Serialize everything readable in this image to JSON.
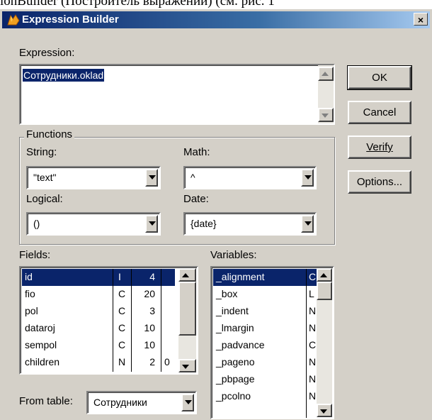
{
  "background_text": "ionBuilder (Построитель выражений) (см. рис. 1",
  "window": {
    "title": "Expression Builder",
    "close_glyph": "×"
  },
  "expression": {
    "label": "Expression:",
    "value": "Сотрудники.oklad"
  },
  "buttons": {
    "ok": "OK",
    "cancel": "Cancel",
    "verify": "Verify",
    "options": "Options..."
  },
  "functions": {
    "title": "Functions",
    "string": {
      "label": "String:",
      "value": "\"text\""
    },
    "math": {
      "label": "Math:",
      "value": "^"
    },
    "logical": {
      "label": "Logical:",
      "value": "()"
    },
    "date": {
      "label": "Date:",
      "value": "{date}"
    }
  },
  "fields": {
    "label": "Fields:",
    "rows": [
      {
        "name": "id",
        "type": "I",
        "width": "4",
        "dec": "",
        "selected": true
      },
      {
        "name": "fio",
        "type": "C",
        "width": "20",
        "dec": ""
      },
      {
        "name": "pol",
        "type": "C",
        "width": "3",
        "dec": ""
      },
      {
        "name": "dataroj",
        "type": "C",
        "width": "10",
        "dec": ""
      },
      {
        "name": "sempol",
        "type": "C",
        "width": "10",
        "dec": ""
      },
      {
        "name": "children",
        "type": "N",
        "width": "2",
        "dec": "0"
      }
    ]
  },
  "variables": {
    "label": "Variables:",
    "rows": [
      {
        "name": "_alignment",
        "type": "C",
        "selected": true
      },
      {
        "name": "_box",
        "type": "L"
      },
      {
        "name": "_indent",
        "type": "N"
      },
      {
        "name": "_lmargin",
        "type": "N"
      },
      {
        "name": "_padvance",
        "type": "C"
      },
      {
        "name": "_pageno",
        "type": "N"
      },
      {
        "name": "_pbpage",
        "type": "N"
      },
      {
        "name": "_pcolno",
        "type": "N"
      }
    ]
  },
  "from_table": {
    "label": "From table:",
    "value": "Сотрудники"
  }
}
